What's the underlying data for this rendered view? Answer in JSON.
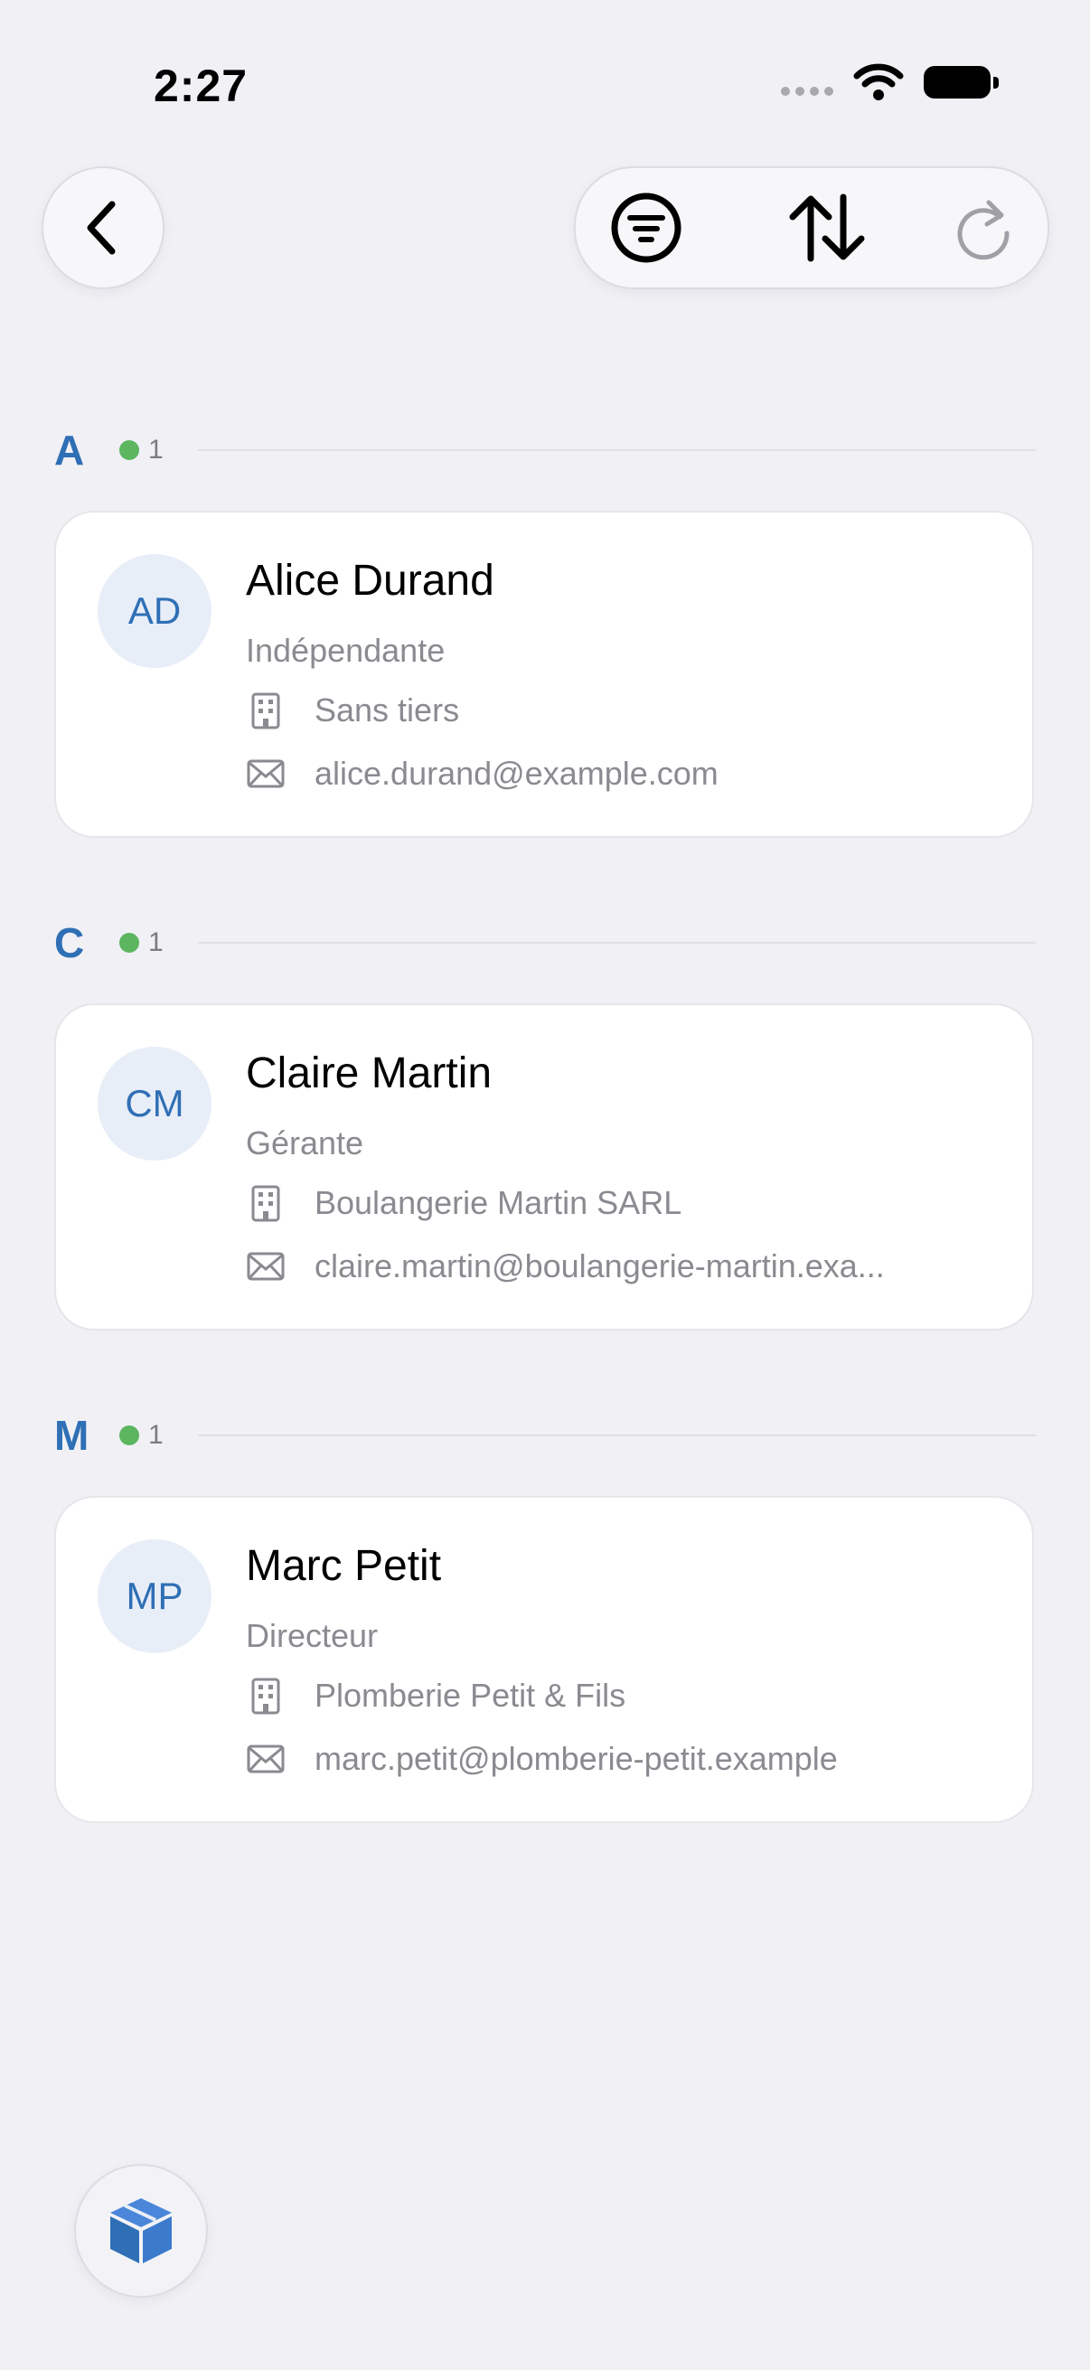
{
  "status": {
    "time": "2:27"
  },
  "toolbar": {
    "back_icon": "chevron-left-icon",
    "filter_icon": "filter-circle-icon",
    "sort_icon": "sort-arrows-icon",
    "refresh_icon": "refresh-icon"
  },
  "sections": [
    {
      "letter": "A",
      "count": "1",
      "contact": {
        "initials": "AD",
        "name": "Alice Durand",
        "role": "Indépendante",
        "company": "Sans tiers",
        "email": "alice.durand@example.com"
      }
    },
    {
      "letter": "C",
      "count": "1",
      "contact": {
        "initials": "CM",
        "name": "Claire Martin",
        "role": "Gérante",
        "company": "Boulangerie Martin SARL",
        "email": "claire.martin@boulangerie-martin.exa..."
      }
    },
    {
      "letter": "M",
      "count": "1",
      "contact": {
        "initials": "MP",
        "name": "Marc Petit",
        "role": "Directeur",
        "company": "Plomberie Petit & Fils",
        "email": "marc.petit@plomberie-petit.example"
      }
    }
  ],
  "colors": {
    "accent": "#2f6fb5",
    "count_dot": "#5bb65f",
    "background": "#f0f0f5"
  },
  "fab": {
    "icon": "cube-icon"
  }
}
